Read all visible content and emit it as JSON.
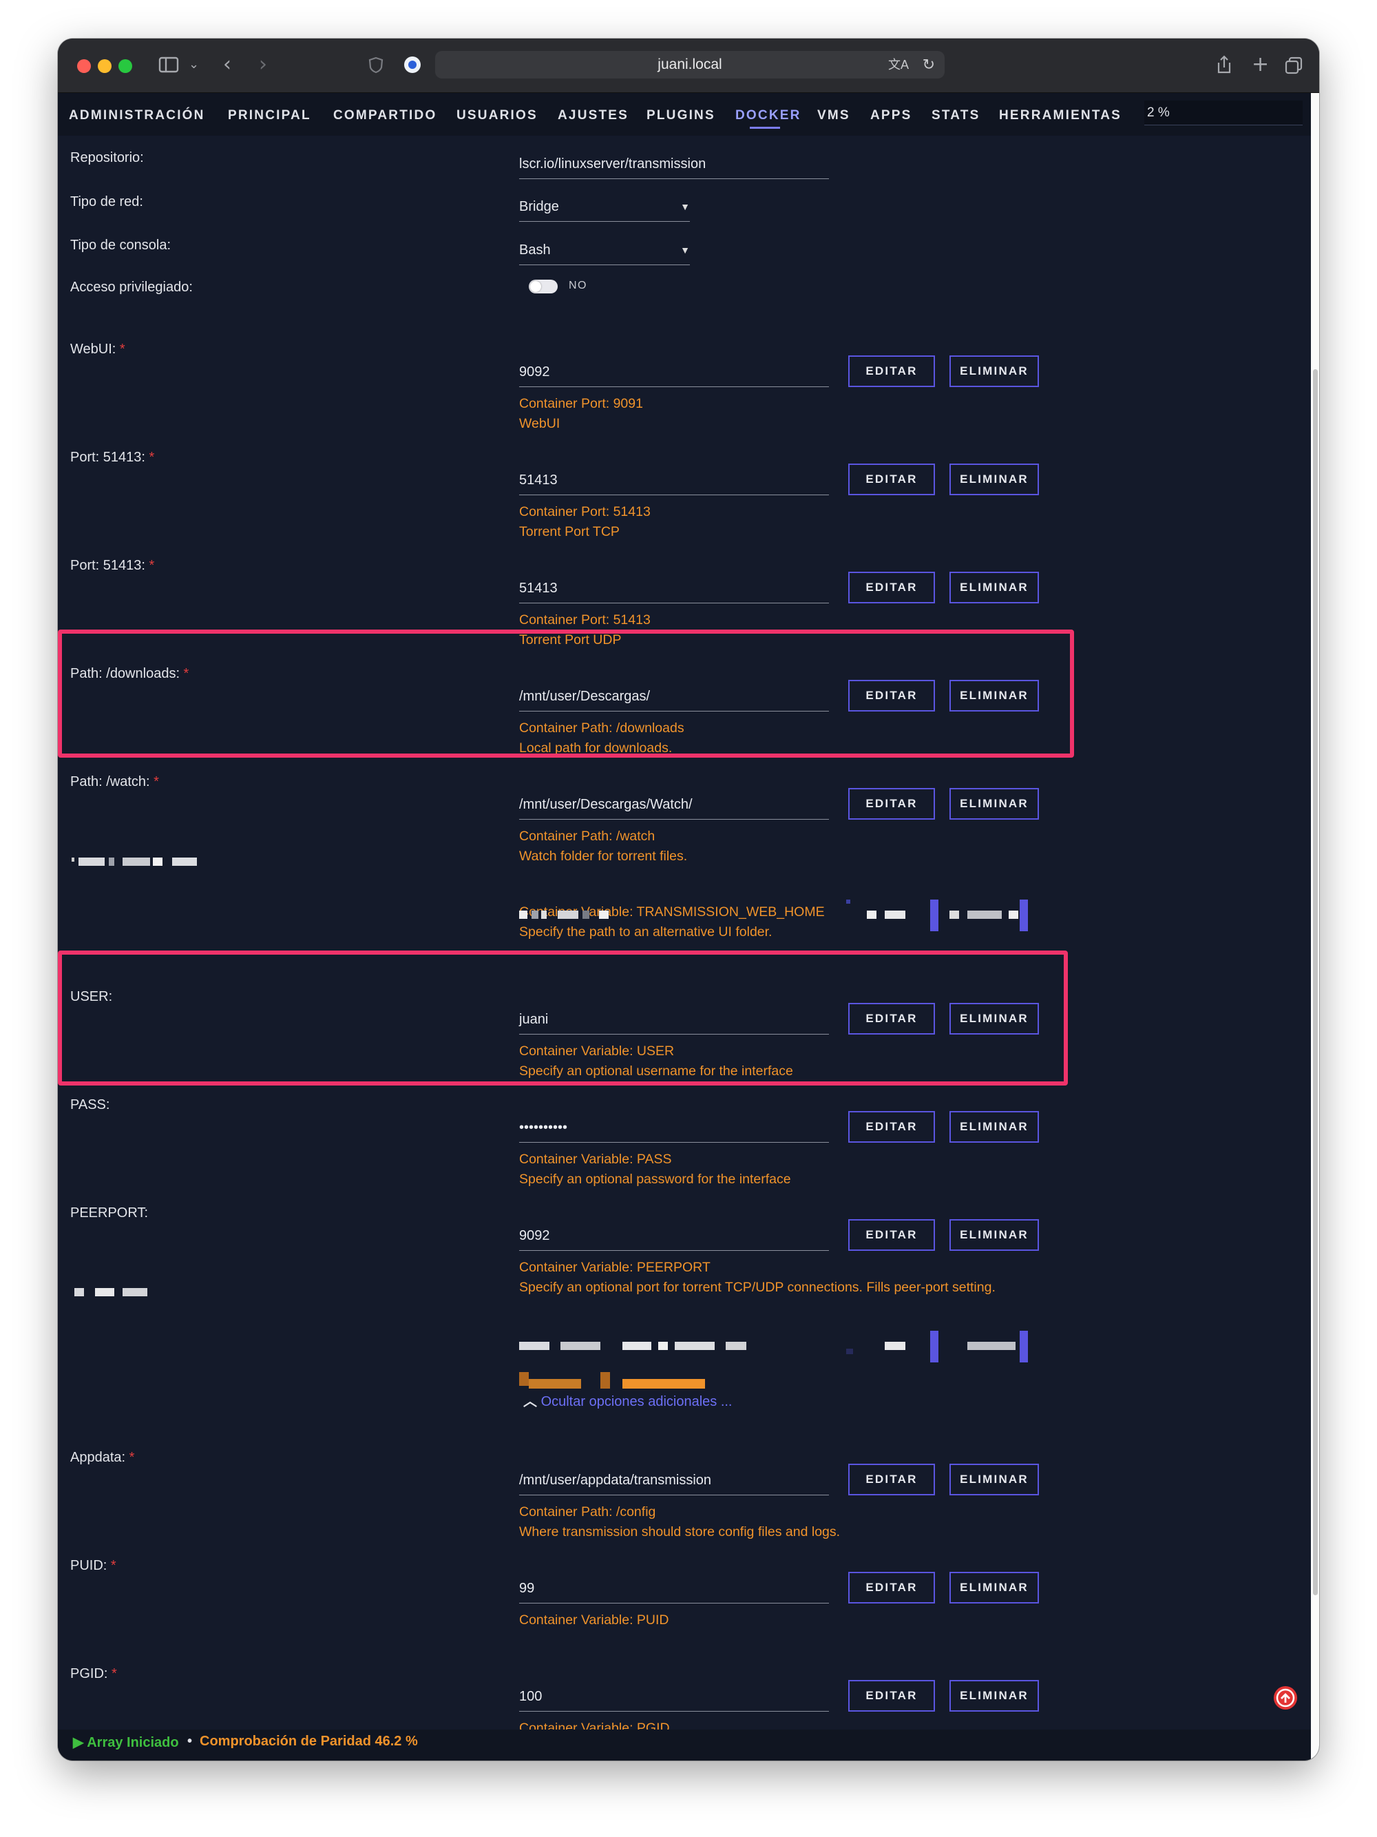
{
  "browser": {
    "url": "juani.local"
  },
  "nav": {
    "items": [
      "ADMINISTRACIÓN",
      "PRINCIPAL",
      "COMPARTIDO",
      "USUARIOS",
      "AJUSTES",
      "PLUGINS",
      "DOCKER",
      "VMS",
      "APPS",
      "STATS",
      "HERRAMIENTAS"
    ],
    "active": "DOCKER",
    "search_value": "2 %"
  },
  "form": {
    "repositorio": {
      "label": "Repositorio:",
      "value": "lscr.io/linuxserver/transmission"
    },
    "tipo_red": {
      "label": "Tipo de red:",
      "value": "Bridge"
    },
    "tipo_consola": {
      "label": "Tipo de consola:",
      "value": "Bash"
    },
    "privilegiado": {
      "label": "Acceso privilegiado:",
      "toggle": "NO"
    },
    "buttons": {
      "edit": "EDITAR",
      "delete": "ELIMINAR"
    },
    "rows": [
      {
        "label": "WebUI:",
        "required": true,
        "value": "9092",
        "desc1": "Container Port: 9091",
        "desc2": "WebUI"
      },
      {
        "label": "Port: 51413:",
        "required": true,
        "value": "51413",
        "desc1": "Container Port: 51413",
        "desc2": "Torrent Port TCP"
      },
      {
        "label": "Port: 51413:",
        "required": true,
        "value": "51413",
        "desc1": "Container Port: 51413",
        "desc2": "Torrent Port UDP"
      },
      {
        "label": "Path: /downloads:",
        "required": true,
        "value": "/mnt/user/Descargas/",
        "desc1": "Container Path: /downloads",
        "desc2": "Local path for downloads."
      },
      {
        "label": "Path: /watch:",
        "required": true,
        "value": "/mnt/user/Descargas/Watch/",
        "desc1": "Container Path: /watch",
        "desc2": "Watch folder for torrent files."
      },
      {
        "label": "",
        "required": false,
        "value": "",
        "desc1": "Container Variable: TRANSMISSION_WEB_HOME",
        "desc2": "Specify the path to an alternative UI folder."
      },
      {
        "label": "USER:",
        "required": false,
        "value": "juani",
        "desc1": "Container Variable: USER",
        "desc2": "Specify an optional username for the interface"
      },
      {
        "label": "PASS:",
        "required": false,
        "value": "••••••••••",
        "desc1": "Container Variable: PASS",
        "desc2": "Specify an optional password for the interface"
      },
      {
        "label": "PEERPORT:",
        "required": false,
        "value": "9092",
        "desc1": "Container Variable: PEERPORT",
        "desc2": "Specify an optional port for torrent TCP/UDP connections. Fills peer-port setting."
      },
      {
        "label": "Appdata:",
        "required": true,
        "value": "/mnt/user/appdata/transmission",
        "desc1": "Container Path: /config",
        "desc2": "Where transmission should store config files and logs."
      },
      {
        "label": "PUID:",
        "required": true,
        "value": "99",
        "desc1": "Container Variable: PUID",
        "desc2": ""
      },
      {
        "label": "PGID:",
        "required": true,
        "value": "100",
        "desc1": "Container Variable: PGID",
        "desc2": ""
      }
    ],
    "hide_options": "Ocultar opciones adicionales ..."
  },
  "footer": {
    "array_status": "Array Iniciado",
    "separator": "•",
    "parity": "Comprobación de Paridad 46.2 %"
  },
  "colors": {
    "accent": "#7b7cf0",
    "description": "#f0932b",
    "highlight": "#f0336a",
    "background": "#141a2a",
    "status_ok": "#3fbf3f"
  }
}
